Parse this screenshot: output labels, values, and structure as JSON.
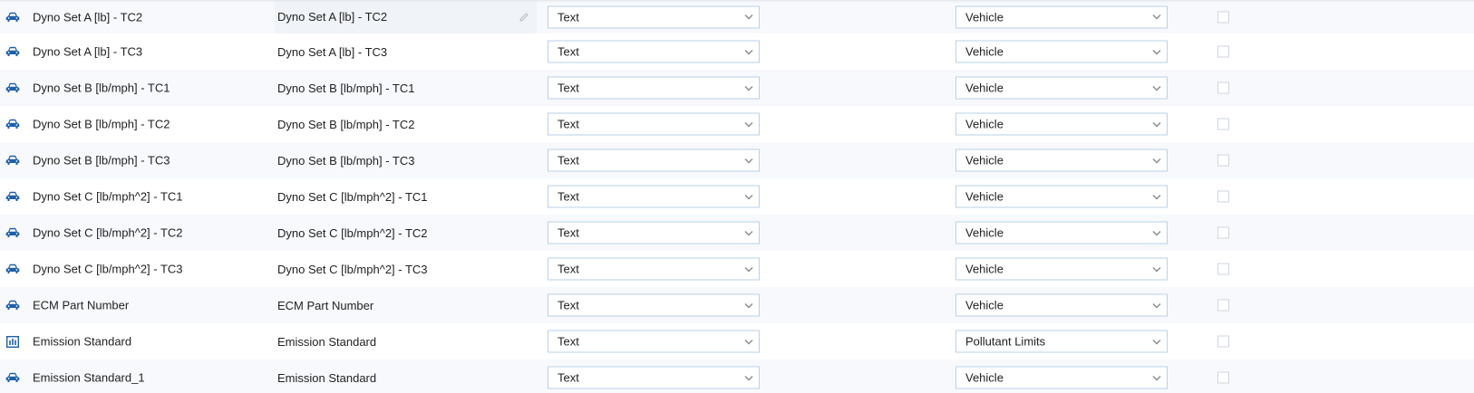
{
  "colors": {
    "icon_blue": "#1f5fa8",
    "select_border": "#b9d1ea",
    "arrow_gray": "#8a8f96"
  },
  "rows": [
    {
      "icon": "car-icon",
      "name": "Dyno Set A [lb] - TC2",
      "display": "Dyno Set A [lb] - TC2",
      "type": "Text",
      "category": "Vehicle",
      "editing": true
    },
    {
      "icon": "car-icon",
      "name": "Dyno Set A [lb] - TC3",
      "display": "Dyno Set A [lb] - TC3",
      "type": "Text",
      "category": "Vehicle"
    },
    {
      "icon": "car-icon",
      "name": "Dyno Set B [lb/mph] - TC1",
      "display": "Dyno Set B [lb/mph] - TC1",
      "type": "Text",
      "category": "Vehicle"
    },
    {
      "icon": "car-icon",
      "name": "Dyno Set B [lb/mph] - TC2",
      "display": "Dyno Set B [lb/mph] - TC2",
      "type": "Text",
      "category": "Vehicle"
    },
    {
      "icon": "car-icon",
      "name": "Dyno Set B [lb/mph] - TC3",
      "display": "Dyno Set B [lb/mph] - TC3",
      "type": "Text",
      "category": "Vehicle"
    },
    {
      "icon": "car-icon",
      "name": "Dyno Set C [lb/mph^2] - TC1",
      "display": "Dyno Set C [lb/mph^2] - TC1",
      "type": "Text",
      "category": "Vehicle"
    },
    {
      "icon": "car-icon",
      "name": "Dyno Set C [lb/mph^2] - TC2",
      "display": "Dyno Set C [lb/mph^2] - TC2",
      "type": "Text",
      "category": "Vehicle"
    },
    {
      "icon": "car-icon",
      "name": "Dyno Set C [lb/mph^2] - TC3",
      "display": "Dyno Set C [lb/mph^2] - TC3",
      "type": "Text",
      "category": "Vehicle"
    },
    {
      "icon": "car-icon",
      "name": "ECM Part Number",
      "display": "ECM Part Number",
      "type": "Text",
      "category": "Vehicle"
    },
    {
      "icon": "bar-chart-icon",
      "name": "Emission Standard",
      "display": "Emission Standard",
      "type": "Text",
      "category": "Pollutant Limits"
    },
    {
      "icon": "car-icon",
      "name": "Emission Standard_1",
      "display": "Emission Standard",
      "type": "Text",
      "category": "Vehicle"
    }
  ]
}
